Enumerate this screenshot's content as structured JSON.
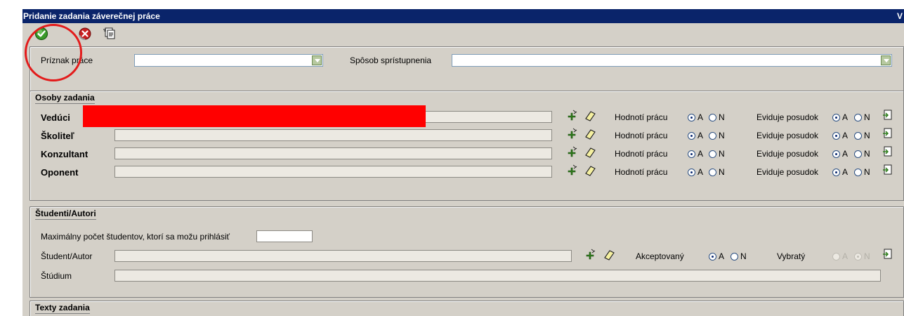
{
  "window": {
    "title": "Pridanie zadania záverečnej práce",
    "title_right": "V"
  },
  "toolbar": {
    "confirm_icon": "green-checkmark-icon",
    "cancel_icon": "red-x-icon",
    "copy_icon": "copy-documents-icon"
  },
  "header": {
    "priznak_label": "Príznak práce",
    "priznak_value": "",
    "sposob_label": "Spôsob sprístupnenia",
    "sposob_value": ""
  },
  "osoby": {
    "title": "Osoby zadania",
    "rows": [
      {
        "label": "Vedúci",
        "value": "",
        "hodnoti_label": "Hodnotí prácu",
        "hodnoti_value": "A",
        "eviduje_label": "Eviduje posudok",
        "eviduje_value": "A"
      },
      {
        "label": "Školiteľ",
        "value": "",
        "hodnoti_label": "Hodnotí prácu",
        "hodnoti_value": "A",
        "eviduje_label": "Eviduje posudok",
        "eviduje_value": "A"
      },
      {
        "label": "Konzultant",
        "value": "",
        "hodnoti_label": "Hodnotí prácu",
        "hodnoti_value": "A",
        "eviduje_label": "Eviduje posudok",
        "eviduje_value": "A"
      },
      {
        "label": "Oponent",
        "value": "",
        "hodnoti_label": "Hodnotí prácu",
        "hodnoti_value": "A",
        "eviduje_label": "Eviduje posudok",
        "eviduje_value": "A"
      }
    ],
    "opt_a": "A",
    "opt_n": "N"
  },
  "studenti": {
    "title": "Študenti/Autori",
    "max_label": "Maximálny počet študentov, ktorí sa možu prihlásiť",
    "max_value": "",
    "student_label": "Študent/Autor",
    "student_value": "",
    "akceptovany_label": "Akceptovaný",
    "akceptovany_value": "A",
    "vybraty_label": "Vybratý",
    "vybraty_value": "N",
    "studium_label": "Štúdium",
    "studium_value": ""
  },
  "texty": {
    "title": "Texty zadania"
  },
  "colors": {
    "titlebar": "#0a246a",
    "dialog": "#d4d0c8",
    "redaction": "#ff0000",
    "annotation": "#e31b1b"
  }
}
